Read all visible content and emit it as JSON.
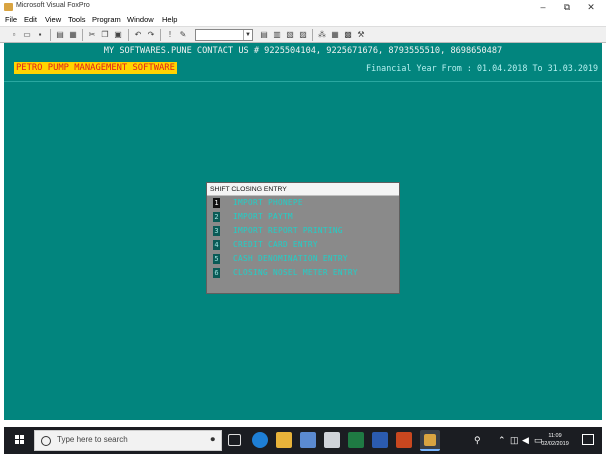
{
  "window": {
    "title": "Microsoft Visual FoxPro",
    "minimize": "–",
    "maximize": "⧉",
    "close": "✕"
  },
  "menu": [
    "File",
    "Edit",
    "View",
    "Tools",
    "Program",
    "Window",
    "Help"
  ],
  "toolbar": {
    "icons": [
      "new-icon",
      "open-icon",
      "save-icon",
      "print-icon",
      "preview-icon",
      "cut-icon",
      "copy-icon",
      "paste-icon",
      "undo-icon",
      "redo-icon",
      "run-icon",
      "modify-icon",
      "command-window-icon",
      "properties-icon",
      "form-icon",
      "report-icon",
      "debug-icon",
      "class-browser-icon",
      "wizard-icon",
      "builder-icon"
    ],
    "combo_value": ""
  },
  "screen": {
    "header": "MY SOFTWARES.PUNE CONTACT US # 9225504104, 9225671676, 8793555510, 8698650487",
    "banner": "PETRO PUMP MANAGEMENT SOFTWARE",
    "financial_year": "Financial Year From : 01.04.2018 To 31.03.2019"
  },
  "dialog": {
    "title": "SHIFT CLOSING ENTRY",
    "items": [
      {
        "key": "1",
        "label": "IMPORT PHONEPE"
      },
      {
        "key": "2",
        "label": "IMPORT PAYTM"
      },
      {
        "key": "3",
        "label": "IMPORT REPORT PRINTING"
      },
      {
        "key": "4",
        "label": "CREDIT CARD ENTRY"
      },
      {
        "key": "5",
        "label": "CASH DENOMINATION ENTRY"
      },
      {
        "key": "6",
        "label": "CLOSING NOSEL METER ENTRY"
      }
    ]
  },
  "taskbar": {
    "search_placeholder": "Type here to search",
    "apps": [
      "task-view-icon",
      "edge-icon",
      "file-explorer-icon",
      "store-icon",
      "mail-icon",
      "excel-icon",
      "word-icon",
      "powerpoint-icon",
      "foxpro-icon"
    ],
    "time": "11:09",
    "date": "02/02/2019",
    "colors": {
      "taskbar": "#1b1d22",
      "desktop": "#02857e",
      "banner_bg": "#ffd400",
      "banner_text": "#e0201b"
    }
  }
}
